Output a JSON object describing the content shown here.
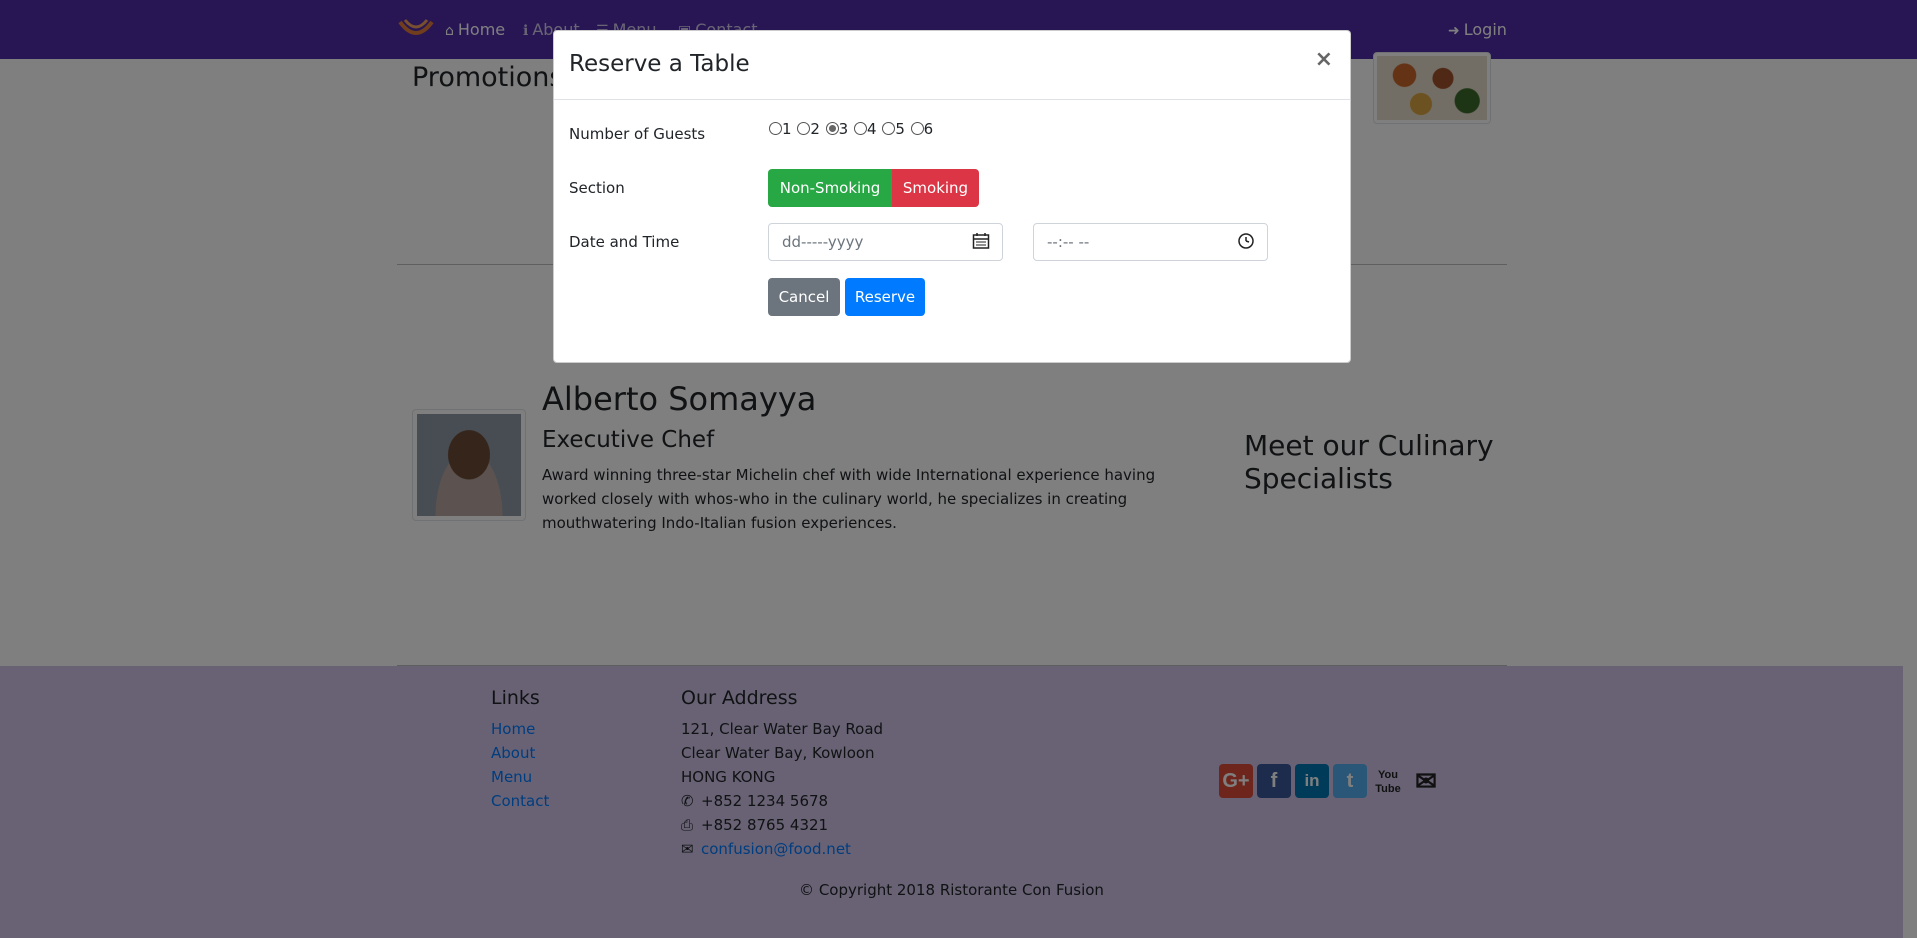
{
  "nav": {
    "links": [
      {
        "label": "Home",
        "icon": "home-icon"
      },
      {
        "label": "About",
        "icon": "info-icon"
      },
      {
        "label": "Menu",
        "icon": "list-icon"
      },
      {
        "label": "Contact",
        "icon": "address-card-icon"
      }
    ],
    "login": "Login",
    "colors": {
      "navbar": "#512da8",
      "footer": "#d1c4e9"
    }
  },
  "main": {
    "promotions_title": "Promotions",
    "leader": {
      "name": "Alberto Somayya",
      "role": "Executive Chef",
      "description": "Award winning three-star Michelin chef with wide International experience having worked closely with whos-who in the culinary world, he specializes in creating mouthwatering Indo-Italian fusion experiences."
    },
    "specialists_heading": "Meet our Culinary Specialists"
  },
  "footer": {
    "links_title": "Links",
    "links": [
      "Home",
      "About",
      "Menu",
      "Contact"
    ],
    "address_title": "Our Address",
    "address": [
      "121, Clear Water Bay Road",
      "Clear Water Bay, Kowloon",
      "HONG KONG"
    ],
    "phone": "+852 1234 5678",
    "fax": "+852 8765 4321",
    "email": "confusion@food.net",
    "social": [
      "google-plus-icon",
      "facebook-icon",
      "linkedin-icon",
      "twitter-icon",
      "youtube-icon",
      "envelope-icon"
    ],
    "copyright": "© Copyright 2018 Ristorante Con Fusion"
  },
  "modal": {
    "title": "Reserve a Table",
    "close": "×",
    "guests_label": "Number of Guests",
    "guest_options": [
      "1",
      "2",
      "3",
      "4",
      "5",
      "6"
    ],
    "guests_selected": "3",
    "section_label": "Section",
    "section_options": [
      "Non-Smoking",
      "Smoking"
    ],
    "datetime_label": "Date and Time",
    "date_placeholder": "dd-----yyyy",
    "time_placeholder": "--:-- --",
    "cancel": "Cancel",
    "reserve": "Reserve",
    "colors": {
      "non_smoking": "#28a745",
      "smoking": "#dc3545",
      "cancel": "#6c757d",
      "reserve": "#007bff"
    }
  }
}
